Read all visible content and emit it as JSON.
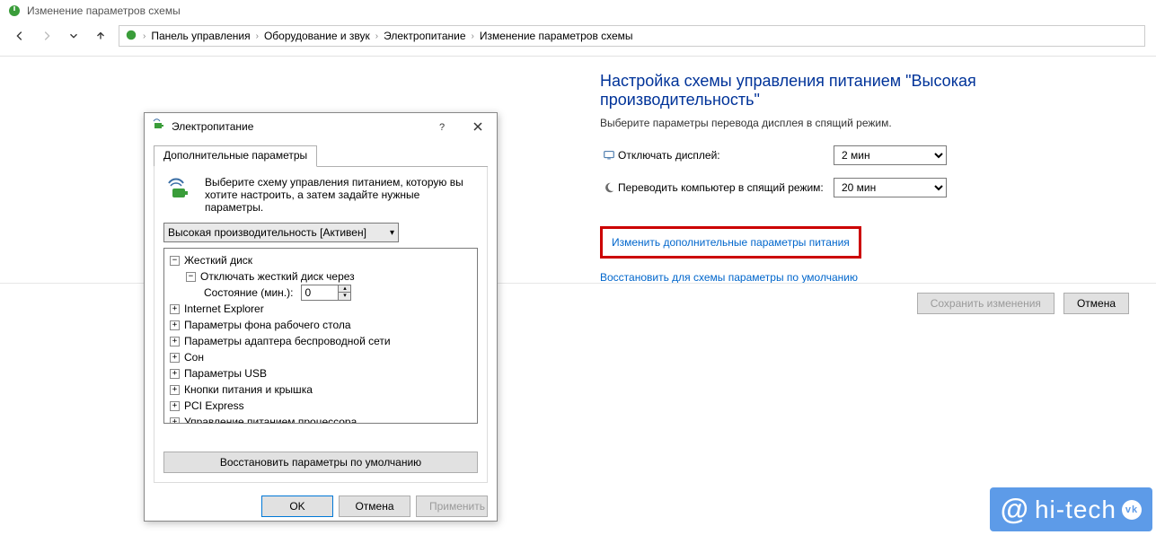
{
  "window_title": "Изменение параметров схемы",
  "breadcrumb": {
    "items": [
      "Панель управления",
      "Оборудование и звук",
      "Электропитание",
      "Изменение параметров схемы"
    ]
  },
  "main": {
    "heading": "Настройка схемы управления питанием \"Высокая производительность\"",
    "subtext": "Выберите параметры перевода дисплея в спящий режим.",
    "row_display": {
      "label": "Отключать дисплей:",
      "value": "2 мин"
    },
    "row_sleep": {
      "label": "Переводить компьютер в спящий режим:",
      "value": "20 мин"
    },
    "link_advanced": "Изменить дополнительные параметры питания",
    "link_restore": "Восстановить для схемы параметры по умолчанию",
    "btn_save": "Сохранить изменения",
    "btn_cancel": "Отмена"
  },
  "dialog": {
    "title": "Электропитание",
    "tab_label": "Дополнительные параметры",
    "intro": "Выберите схему управления питанием, которую вы хотите настроить, а затем задайте нужные параметры.",
    "plan_selected": "Высокая производительность [Активен]",
    "tree": {
      "hdd": "Жесткий диск",
      "hdd_off": "Отключать жесткий диск через",
      "hdd_state_label": "Состояние (мин.):",
      "hdd_state_value": "0",
      "ie": "Internet Explorer",
      "wallpaper": "Параметры фона рабочего стола",
      "wifi": "Параметры адаптера беспроводной сети",
      "sleep": "Сон",
      "usb": "Параметры USB",
      "lid": "Кнопки питания и крышка",
      "pci": "PCI Express",
      "cpu": "Управление питанием процессора"
    },
    "restore_defaults": "Восстановить параметры по умолчанию",
    "btn_ok": "OK",
    "btn_cancel": "Отмена",
    "btn_apply": "Применить"
  },
  "watermark": {
    "brand_at": "@",
    "brand": "hi-tech",
    "vk": "vk"
  }
}
